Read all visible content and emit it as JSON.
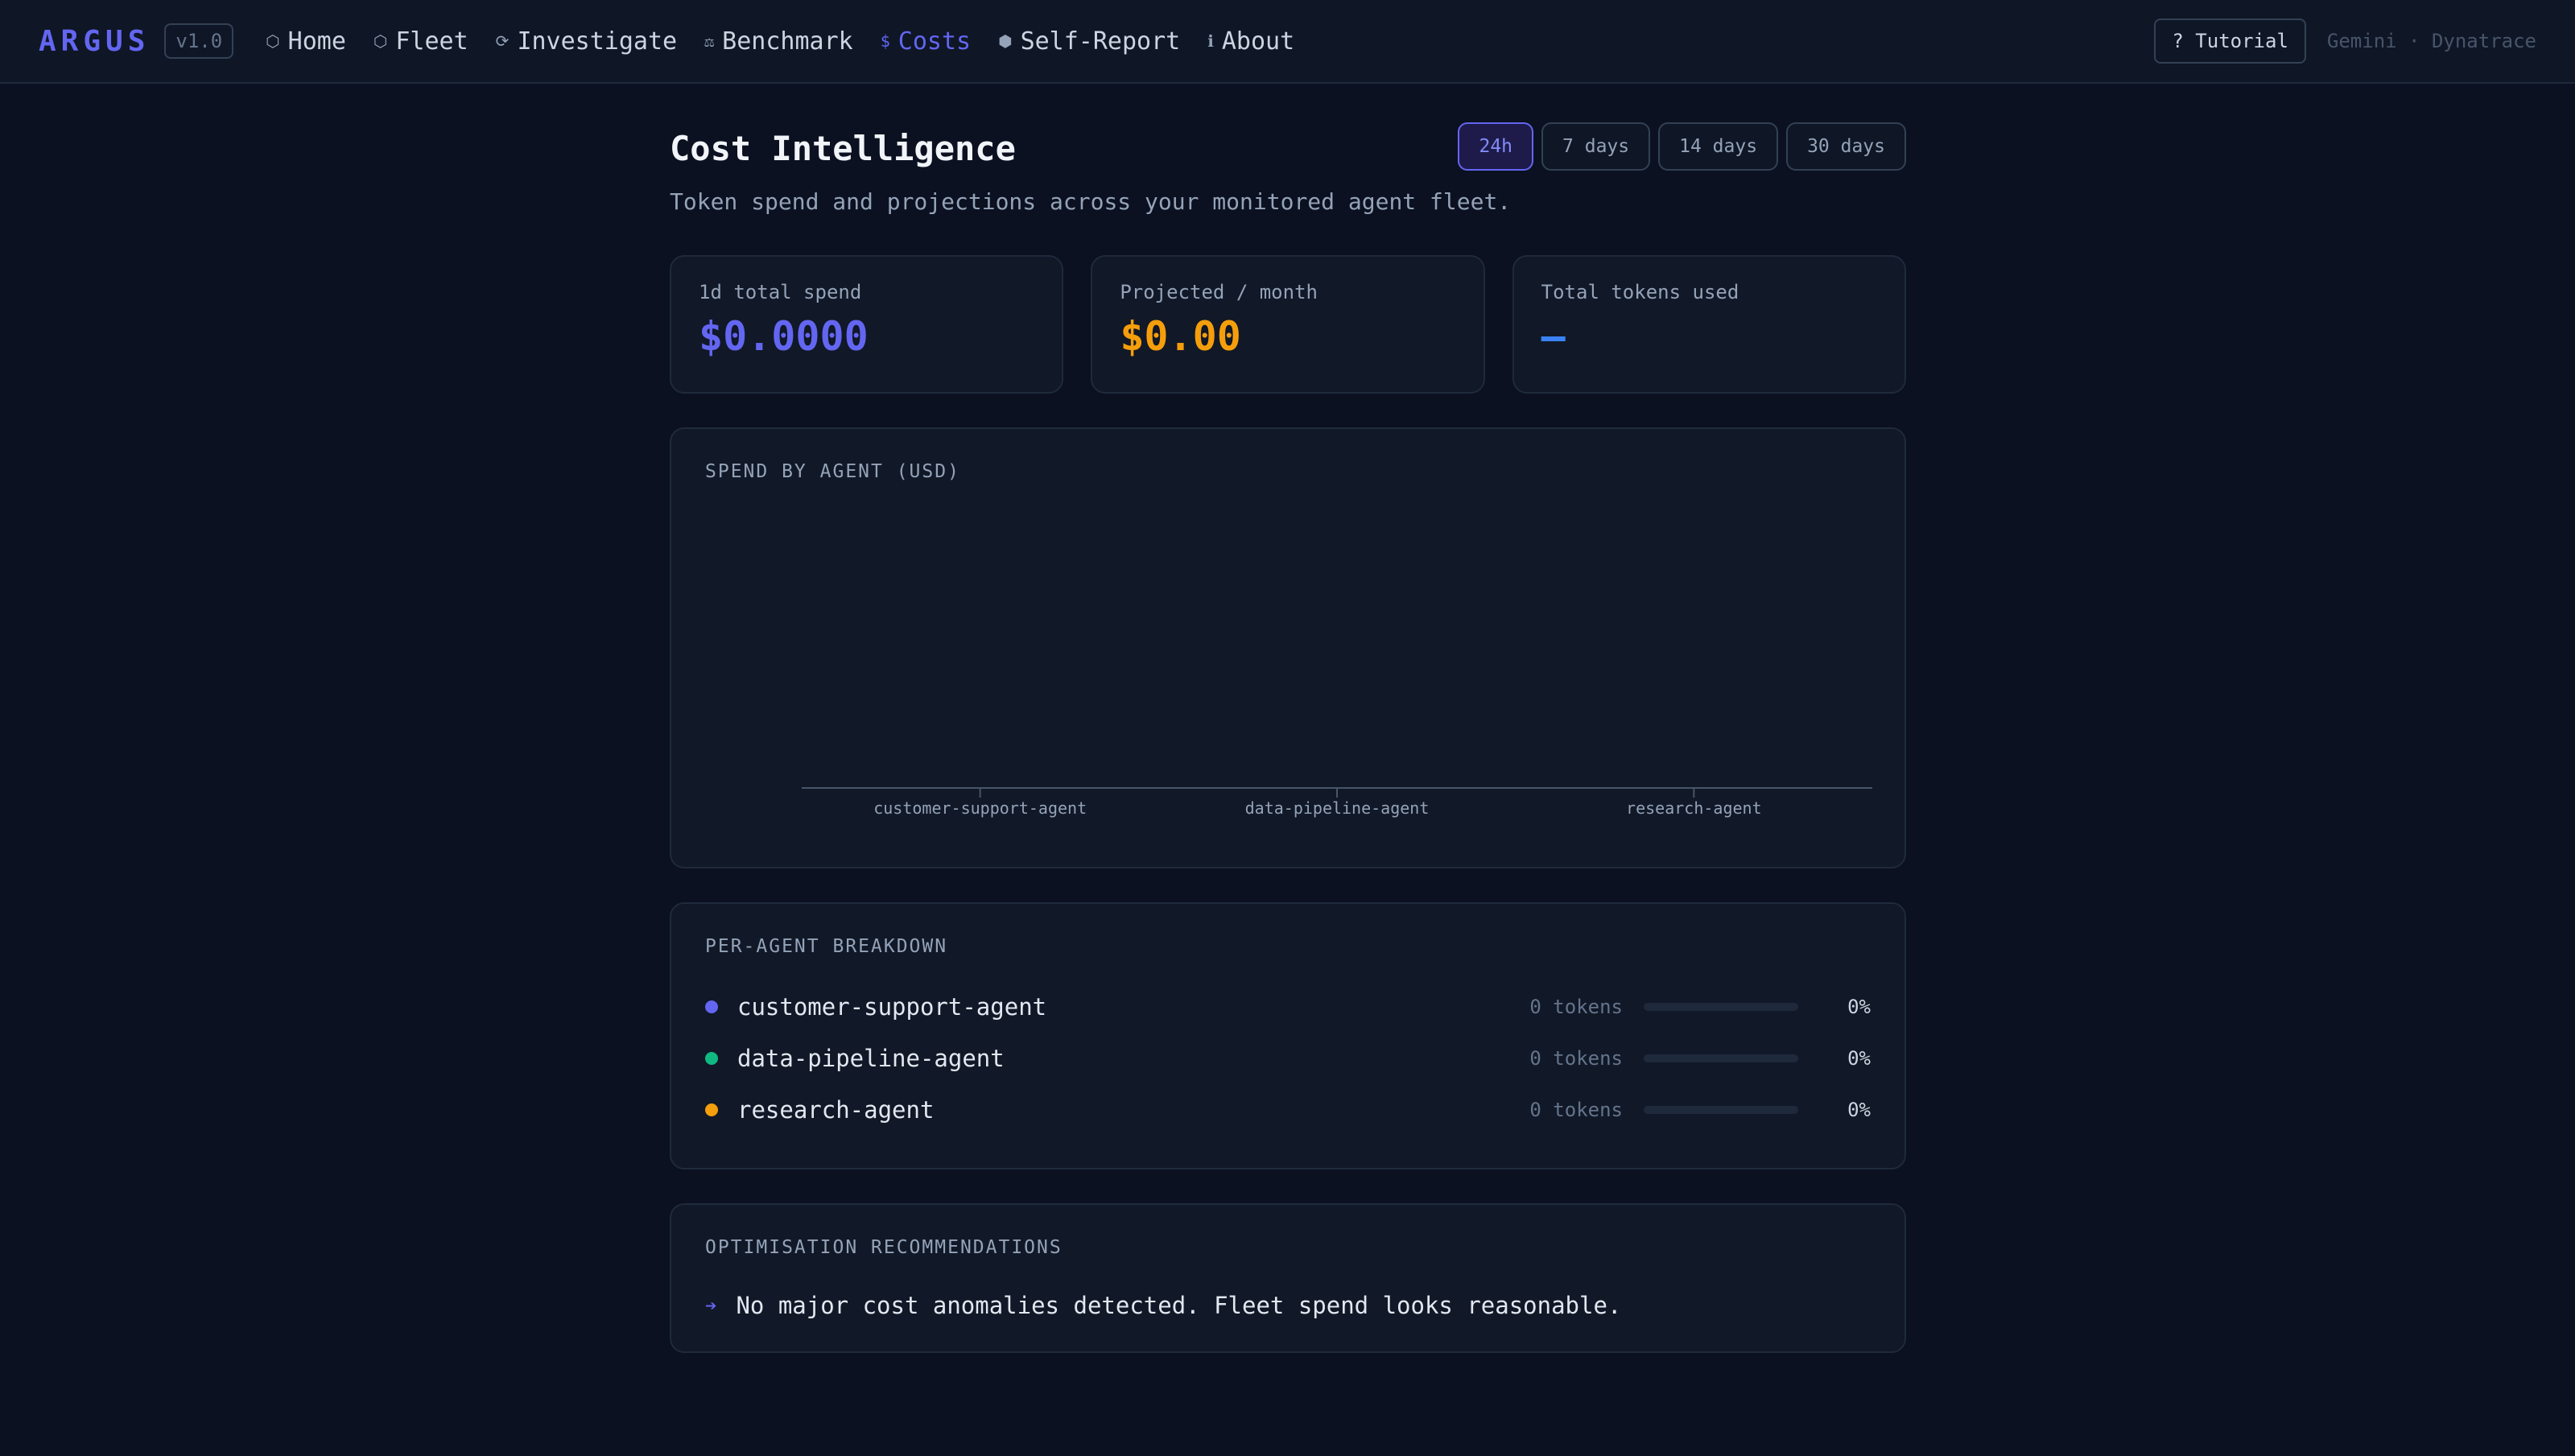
{
  "nav": {
    "brand": "ARGUS",
    "version": "v1.0",
    "links": [
      {
        "label": "Home",
        "icon": "⬡"
      },
      {
        "label": "Fleet",
        "icon": "⬡"
      },
      {
        "label": "Investigate",
        "icon": "⟳"
      },
      {
        "label": "Benchmark",
        "icon": "⚖"
      },
      {
        "label": "Costs",
        "icon": "$",
        "active": true
      },
      {
        "label": "Self-Report",
        "icon": "⬢"
      },
      {
        "label": "About",
        "icon": "ℹ"
      }
    ],
    "tutorial_label": "? Tutorial",
    "powered_by": "Gemini · Dynatrace"
  },
  "page": {
    "title": "Cost Intelligence",
    "subtitle": "Token spend and projections across your monitored agent fleet.",
    "range_tabs": [
      "24h",
      "7 days",
      "14 days",
      "30 days"
    ],
    "active_range": "24h"
  },
  "stats": [
    {
      "label": "1d total spend",
      "value": "$0.0000",
      "color": "#6366f1"
    },
    {
      "label": "Projected / month",
      "value": "$0.00",
      "color": "#f59e0b"
    },
    {
      "label": "Total tokens used",
      "value": "—",
      "color": "#3b82f6"
    }
  ],
  "chart_data": {
    "type": "bar",
    "title": "SPEND BY AGENT (USD)",
    "categories": [
      "customer-support-agent",
      "data-pipeline-agent",
      "research-agent"
    ],
    "values": [
      0,
      0,
      0
    ],
    "xlabel": "",
    "ylabel": "",
    "grid": false
  },
  "breakdown": {
    "title": "PER-AGENT BREAKDOWN",
    "rows": [
      {
        "name": "customer-support-agent",
        "color": "#6366f1",
        "tokens": "0 tokens",
        "pct": "0%",
        "share": 0
      },
      {
        "name": "data-pipeline-agent",
        "color": "#10b981",
        "tokens": "0 tokens",
        "pct": "0%",
        "share": 0
      },
      {
        "name": "research-agent",
        "color": "#f59e0b",
        "tokens": "0 tokens",
        "pct": "0%",
        "share": 0
      }
    ]
  },
  "recommendations": {
    "title": "OPTIMISATION RECOMMENDATIONS",
    "items": [
      "No major cost anomalies detected. Fleet spend looks reasonable."
    ]
  }
}
